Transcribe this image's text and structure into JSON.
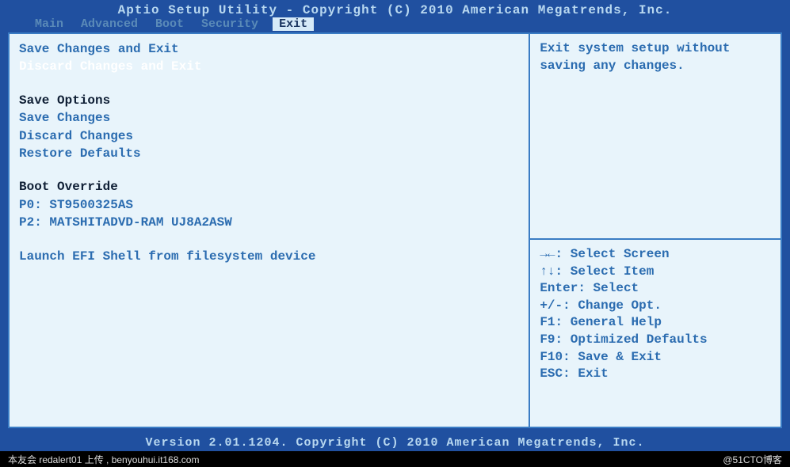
{
  "title": "Aptio Setup Utility - Copyright (C) 2010 American Megatrends, Inc.",
  "tabs": {
    "main": "Main",
    "advanced": "Advanced",
    "boot": "Boot",
    "security": "Security",
    "exit": "Exit"
  },
  "menu": {
    "save_exit": "Save Changes and Exit",
    "discard_exit": "Discard Changes and Exit",
    "save_options_header": "Save Options",
    "save_changes": "Save Changes",
    "discard_changes": "Discard Changes",
    "restore_defaults": "Restore Defaults",
    "boot_override_header": "Boot Override",
    "boot0": "P0: ST9500325AS",
    "boot1": "P2: MATSHITADVD-RAM UJ8A2ASW",
    "launch_efi": "Launch EFI Shell from filesystem device"
  },
  "help_text": "Exit system setup without saving any changes.",
  "keys": {
    "k1": "→←: Select Screen",
    "k2": "↑↓: Select Item",
    "k3": "Enter: Select",
    "k4": "+/-: Change Opt.",
    "k5": "F1: General Help",
    "k6": "F9: Optimized Defaults",
    "k7": "F10: Save & Exit",
    "k8": "ESC: Exit"
  },
  "footer": "Version 2.01.1204. Copyright (C) 2010 American Megatrends, Inc.",
  "credit_left": "本友会 redalert01 上传 , benyouhui.it168.com",
  "credit_right": "@51CTO博客"
}
